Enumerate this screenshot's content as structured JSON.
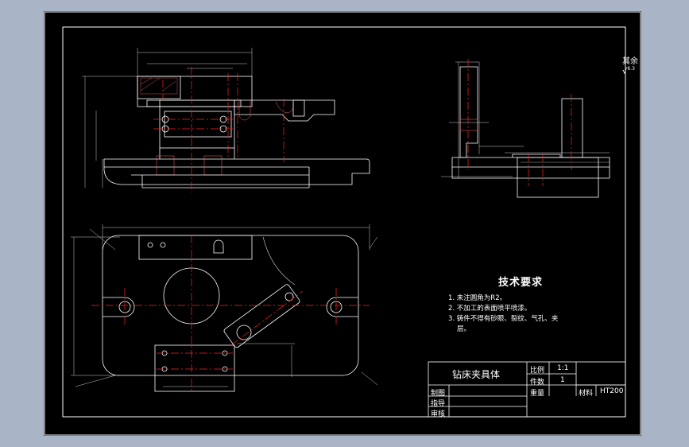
{
  "surface_finish": {
    "label": "其余",
    "value": "6.3"
  },
  "technical_requirements": {
    "title": "技术要求",
    "items": [
      "1. 未注圆角为R2。",
      "2. 不加工的表面喷平喷漆。",
      "3. 铸件不得有砂眼、裂纹、气孔、夹",
      "层。"
    ]
  },
  "title_block": {
    "part_name": "钻床夹具体",
    "scale_label": "比例",
    "scale_value": "1:1",
    "quantity_label": "件数",
    "quantity_value": "1",
    "weight_label": "重量",
    "material_label": "材料",
    "material_value": "HT200",
    "drawn_by_label": "制图",
    "designer_label": "指导",
    "reviewer_label": "审核"
  },
  "colors": {
    "background": "#a9b4c6",
    "sheet": "#000000",
    "line": "#ffffff",
    "centerline": "#ff2020",
    "dimension": "#d9d9d9"
  }
}
